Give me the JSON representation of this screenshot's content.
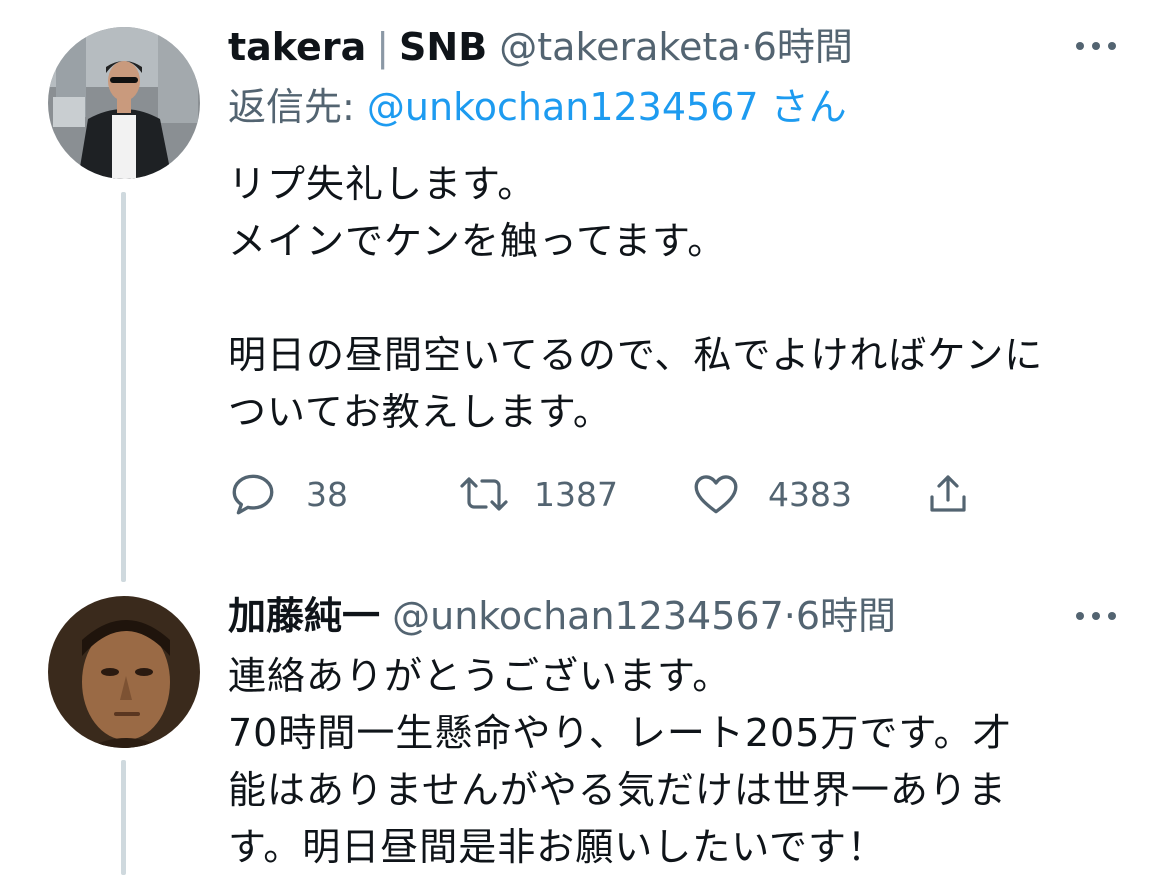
{
  "tweets": [
    {
      "display_name": "takera",
      "separator": "|",
      "display_name_suffix": "SNB",
      "handle": "@takeraketa",
      "dot": "·",
      "time": "6時間",
      "replying_prefix": "返信先:",
      "replying_to": "@unkochan1234567",
      "replying_suffix": "さん",
      "text": "リプ失礼します。\nメインでケンを触ってます。\n\n明日の昼間空いてるので、私でよければケンに\nついてお教えします。",
      "actions": {
        "replies": "38",
        "retweets": "1387",
        "likes": "4383"
      }
    },
    {
      "display_name": "加藤純一",
      "handle": "@unkochan1234567",
      "dot": "·",
      "time": "6時間",
      "text": "連絡ありがとうございます。\n70時間一生懸命やり、レート205万です。才\n能はありませんがやる気だけは世界一ありま\nす。明日昼間是非お願いしたいです！"
    }
  ],
  "icons": {
    "more": "more-horizontal-icon",
    "reply": "reply-icon",
    "retweet": "retweet-icon",
    "like": "heart-icon",
    "share": "share-icon"
  },
  "colors": {
    "text": "#0f1419",
    "secondary": "#536471",
    "link": "#1d9bf0",
    "thread_line": "#cfd9de"
  }
}
